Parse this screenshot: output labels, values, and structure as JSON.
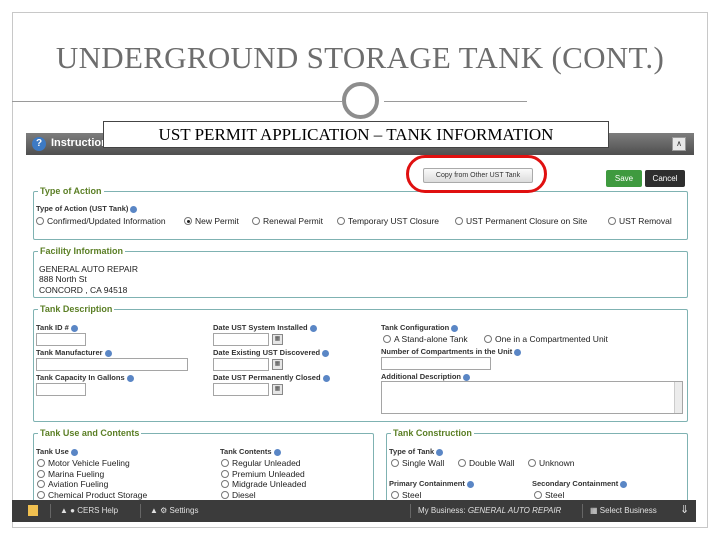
{
  "slide": {
    "title": "UNDERGROUND STORAGE TANK (CONT.)"
  },
  "overlay_title": "UST PERMIT APPLICATION – TANK INFORMATION",
  "window": {
    "title_fragment": "Instruction"
  },
  "actions": {
    "copy_label": "Copy from Other UST Tank",
    "save_label": "Save",
    "cancel_label": "Cancel"
  },
  "type_of_action": {
    "legend": "Type of Action",
    "label": "Type of Action (UST Tank)",
    "options": [
      "Confirmed/Updated Information",
      "New Permit",
      "Renewal Permit",
      "Temporary UST Closure",
      "UST Permanent Closure on Site",
      "UST Removal"
    ],
    "selected": "New Permit"
  },
  "facility": {
    "legend": "Facility Information",
    "name": "GENERAL AUTO REPAIR",
    "street": "888 North St",
    "city_line": "CONCORD ,  CA  94518"
  },
  "tank_description": {
    "legend": "Tank Description",
    "tank_id_label": "Tank ID #",
    "manufacturer_label": "Tank Manufacturer",
    "capacity_label": "Tank Capacity In Gallons",
    "date_installed_label": "Date UST System Installed",
    "date_discovered_label": "Date Existing UST Discovered",
    "date_closed_label": "Date UST Permanently Closed",
    "config_label": "Tank Configuration",
    "config_options": [
      "A Stand-alone Tank",
      "One in a Compartmented Unit"
    ],
    "compartments_label": "Number of Compartments in the Unit",
    "additional_label": "Additional Description"
  },
  "tank_use": {
    "legend": "Tank Use and Contents",
    "use_label": "Tank Use",
    "use_options": [
      "Motor Vehicle Fueling",
      "Marina Fueling",
      "Aviation Fueling",
      "Chemical Product Storage"
    ],
    "contents_label": "Tank Contents",
    "contents_options": [
      "Regular Unleaded",
      "Premium Unleaded",
      "Midgrade Unleaded",
      "Diesel"
    ]
  },
  "tank_construction": {
    "legend": "Tank Construction",
    "type_label": "Type of Tank",
    "type_options": [
      "Single Wall",
      "Double Wall",
      "Unknown"
    ],
    "primary_label": "Primary Containment",
    "primary_option": "Steel",
    "secondary_label": "Secondary Containment",
    "secondary_option": "Steel"
  },
  "bottom_bar": {
    "help": "CERS Help",
    "settings": "Settings",
    "my_business_label": "My Business:",
    "business_name": "GENERAL AUTO REPAIR",
    "select_business": "Select Business"
  },
  "colors": {
    "highlight_ring": "#e01010",
    "save_button": "#3f9a3f",
    "legend_text": "#5b7f25",
    "fieldset_border": "#7fb2b2"
  }
}
